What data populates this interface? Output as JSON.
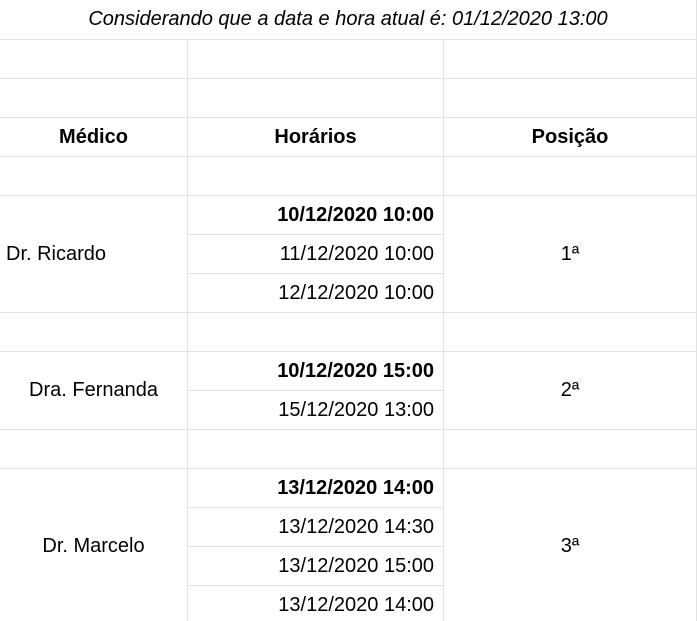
{
  "note": "Considerando que a data e hora atual é: 01/12/2020 13:00",
  "headers": {
    "medico": "Médico",
    "horarios": "Horários",
    "posicao": "Posição"
  },
  "groups": [
    {
      "medico": "Dr. Ricardo",
      "posicao": "1ª",
      "horarios": [
        "10/12/2020 10:00",
        "11/12/2020 10:00",
        "12/12/2020 10:00"
      ]
    },
    {
      "medico": "Dra. Fernanda",
      "posicao": "2ª",
      "horarios": [
        "10/12/2020 15:00",
        "15/12/2020 13:00"
      ]
    },
    {
      "medico": "Dr. Marcelo",
      "posicao": "3ª",
      "horarios": [
        "13/12/2020 14:00",
        "13/12/2020 14:30",
        "13/12/2020 15:00",
        "13/12/2020 14:00"
      ]
    }
  ]
}
